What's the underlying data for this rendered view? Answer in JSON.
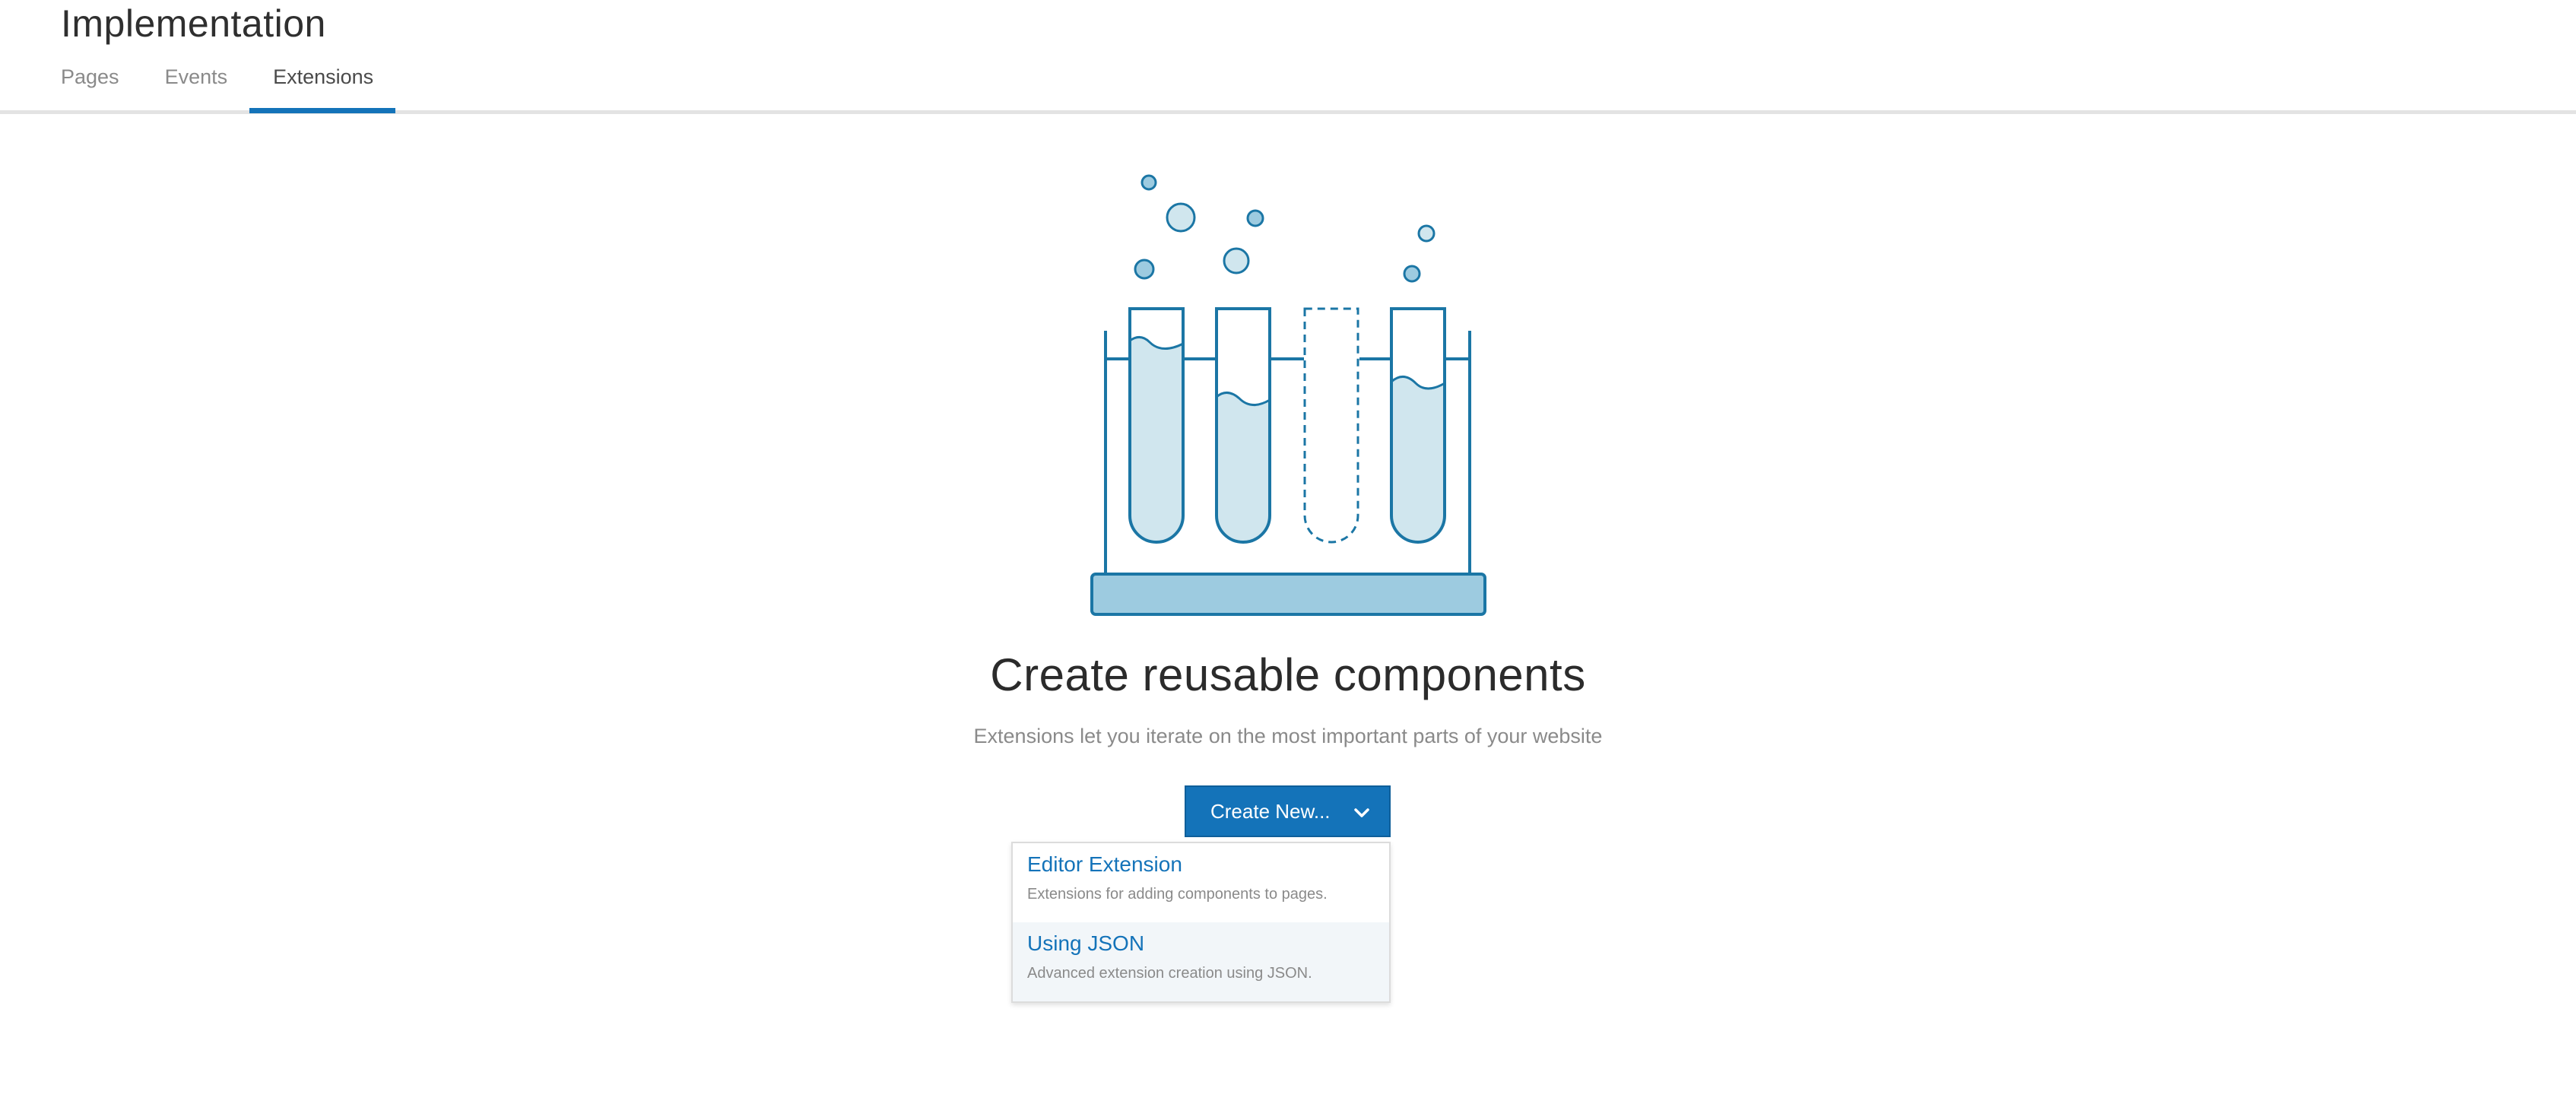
{
  "header": {
    "title": "Implementation",
    "tabs": [
      {
        "label": "Pages",
        "active": false
      },
      {
        "label": "Events",
        "active": false
      },
      {
        "label": "Extensions",
        "active": true
      }
    ]
  },
  "empty_state": {
    "illustration": "test-tubes-rack-icon",
    "headline": "Create reusable components",
    "subhead": "Extensions let you iterate on the most important parts of your website"
  },
  "create_button": {
    "label": "Create New...",
    "icon": "chevron-down-icon"
  },
  "create_menu": {
    "items": [
      {
        "title": "Editor Extension",
        "description": "Extensions for adding components to pages.",
        "hovered": false
      },
      {
        "title": "Using JSON",
        "description": "Advanced extension creation using JSON.",
        "hovered": true
      }
    ]
  },
  "colors": {
    "accent": "#1473b9",
    "illustration_stroke": "#1b76a5",
    "illustration_fill": "#d0e6ee",
    "rack_base_fill": "#9dcbe0",
    "hover_bg": "#f2f6f9"
  }
}
